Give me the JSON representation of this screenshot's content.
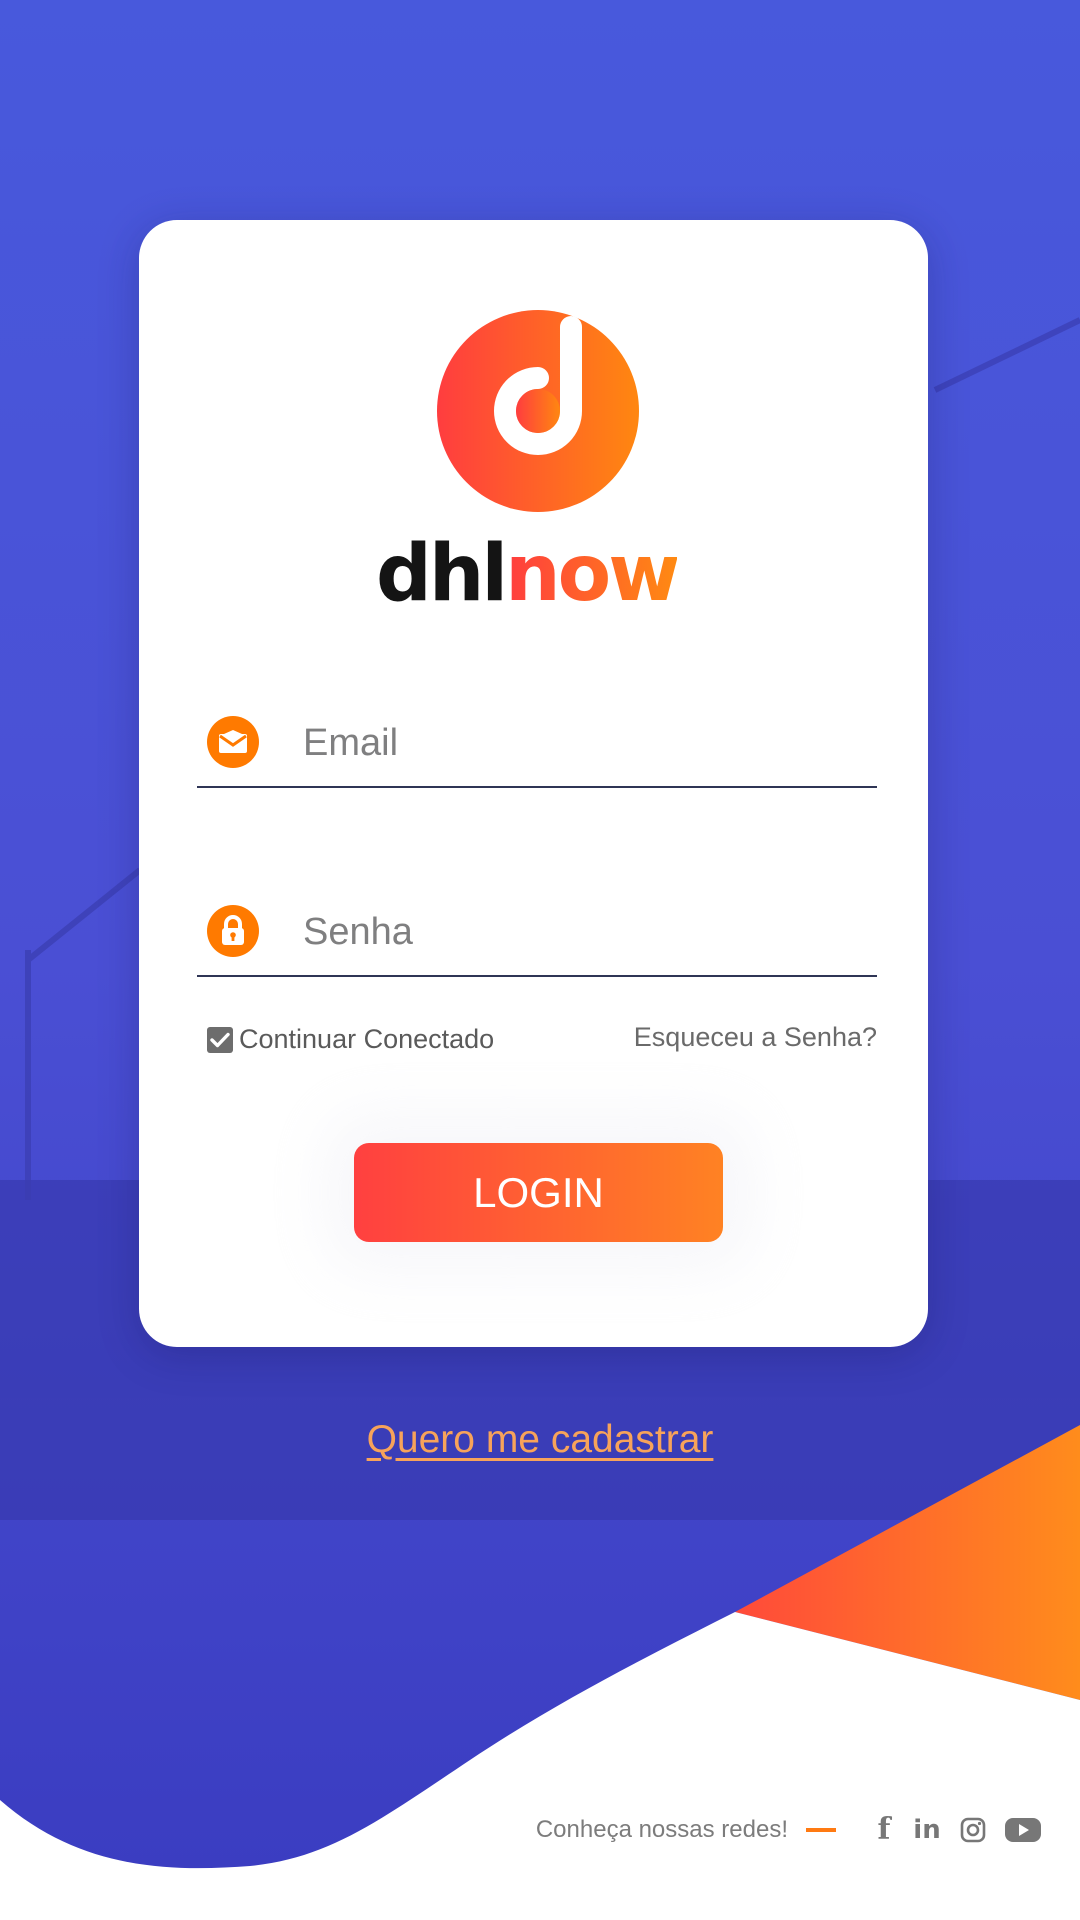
{
  "brand": {
    "name_dark": "dhl",
    "name_accent": "now"
  },
  "login_form": {
    "email_placeholder": "Email",
    "password_placeholder": "Senha",
    "remember_label": "Continuar Conectado",
    "remember_checked": true,
    "forgot_label": "Esqueceu a Senha?",
    "login_label": "LOGIN"
  },
  "register_link": "Quero me cadastrar",
  "social": {
    "label": "Conheça nossas redes!",
    "icons": [
      "facebook-icon",
      "linkedin-icon",
      "instagram-icon",
      "youtube-icon"
    ]
  },
  "colors": {
    "background_blue": "#4a55d8",
    "accent_orange": "#ff7a00",
    "accent_red": "#ff3d3f",
    "text_gray": "#7c7c7c"
  }
}
